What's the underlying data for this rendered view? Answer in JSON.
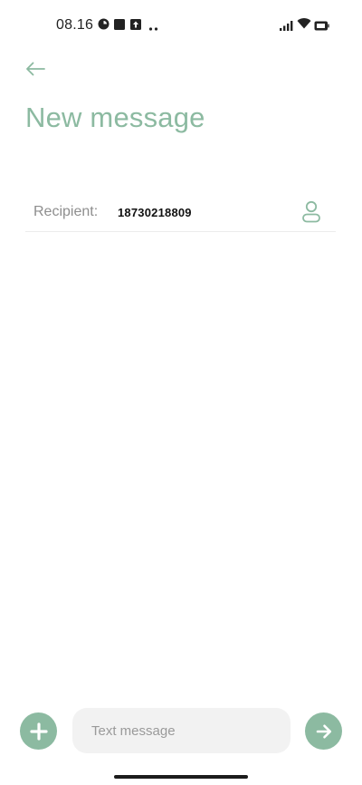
{
  "status_bar": {
    "time": "08.16",
    "icons": [
      "data-saver-icon",
      "square-notification-icon",
      "upload-notification-icon",
      "more-notifications-icon",
      "signal-icon",
      "wifi-icon",
      "battery-icon"
    ]
  },
  "header": {
    "title": "New message"
  },
  "recipient": {
    "label": "Recipient:",
    "value": "18730218809"
  },
  "compose": {
    "placeholder": "Text message"
  },
  "colors": {
    "accent": "#8cbaa1",
    "input_bg": "#f2f2f2"
  }
}
